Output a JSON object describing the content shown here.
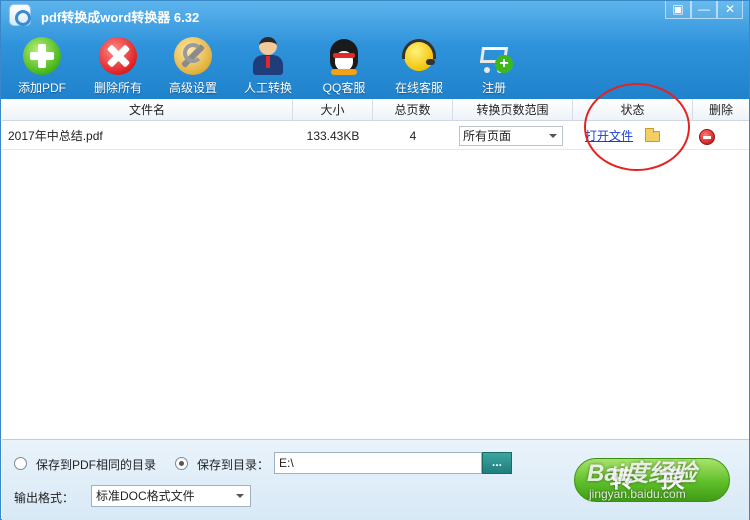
{
  "window": {
    "title": "pdf转换成word转换器 6.32",
    "controls": {
      "menu": "▣",
      "minimize": "—",
      "close": "✕"
    }
  },
  "toolbar": {
    "add_pdf": "添加PDF",
    "delete_all": "删除所有",
    "advanced_settings": "高级设置",
    "manual_convert": "人工转换",
    "qq_service": "QQ客服",
    "online_service": "在线客服",
    "register": "注册"
  },
  "table": {
    "headers": [
      "文件名",
      "大小",
      "总页数",
      "转换页数范围",
      "状态",
      "删除"
    ],
    "rows": [
      {
        "filename": "2017年中总结.pdf",
        "size": "133.43KB",
        "pages": "4",
        "range": "所有页面",
        "status": "打开文件"
      }
    ]
  },
  "bottom": {
    "save_same_dir": "保存到PDF相同的目录",
    "save_to_dir": "保存到目录：",
    "save_path": "E:\\",
    "browse": "...",
    "output_format_label": "输出格式：",
    "output_format": "标准DOC格式文件",
    "convert": "转 换"
  },
  "watermark": {
    "main": "Bai度经验",
    "sub": "jingyan.baidu.com"
  },
  "colors": {
    "title_bar": "#2f93db",
    "link": "#1a3fd0",
    "annotation": "#e42222",
    "convert_button": "#5fbf2a"
  },
  "icons": {
    "add_pdf": "green-plus-icon",
    "delete_all": "red-x-icon",
    "advanced_settings": "wrench-icon",
    "manual_convert": "agent-person-icon",
    "qq_service": "qq-penguin-icon",
    "online_service": "headset-smiley-icon",
    "register": "cart-plus-icon",
    "folder": "folder-icon",
    "delete_row": "remove-circle-icon"
  }
}
